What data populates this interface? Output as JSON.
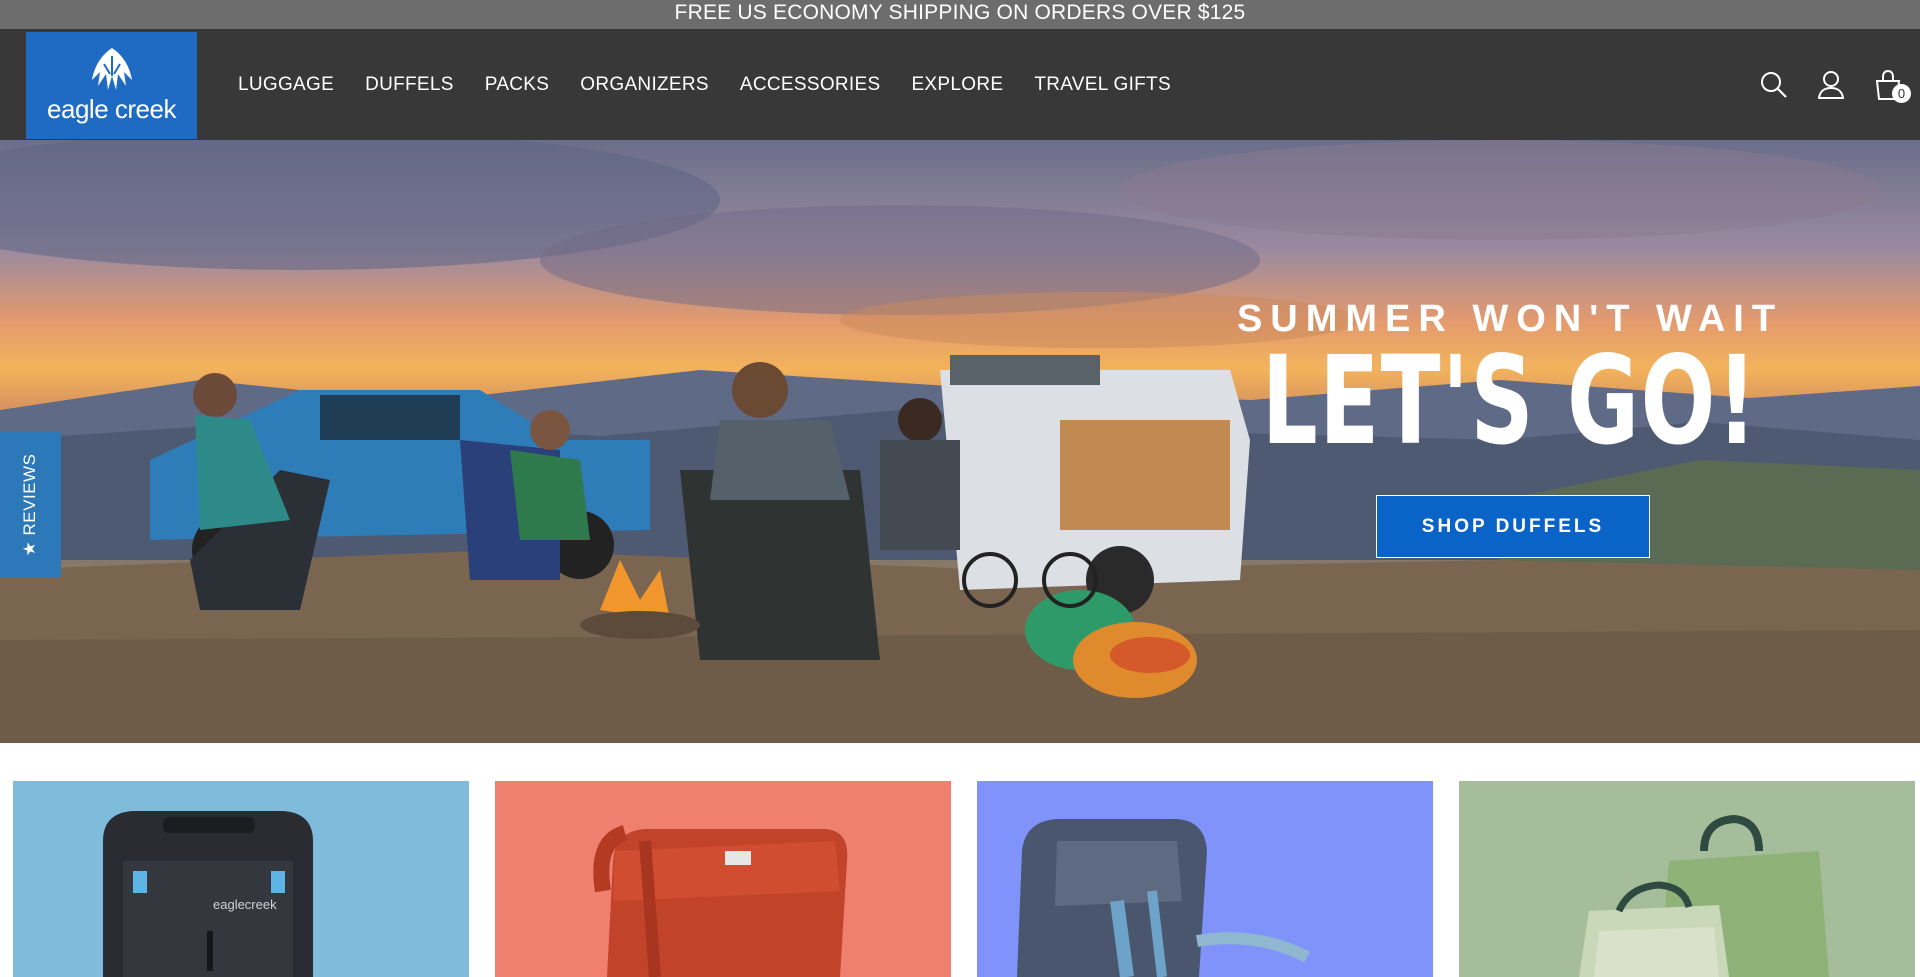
{
  "announcement": {
    "text": "FREE US ECONOMY SHIPPING ON ORDERS OVER $125"
  },
  "header": {
    "logo_text": "eagle creek",
    "nav": [
      "LUGGAGE",
      "DUFFELS",
      "PACKS",
      "ORGANIZERS",
      "ACCESSORIES",
      "EXPLORE",
      "TRAVEL GIFTS"
    ],
    "icons": [
      "search-icon",
      "account-icon",
      "cart-icon"
    ],
    "cart_count": "0"
  },
  "hero": {
    "eyebrow": "SUMMER WON'T WAIT",
    "title": "LET'S GO!",
    "cta": "SHOP DUFFELS"
  },
  "reviews_tab": {
    "label": "★ REVIEWS"
  },
  "tiles": [
    {
      "bg": "#7fbcdc",
      "product": "rolling-luggage"
    },
    {
      "bg": "#ef7f6e",
      "product": "backpack"
    },
    {
      "bg": "#7f93fb",
      "product": "duffel-pack"
    },
    {
      "bg": "#a6bd9c",
      "product": "packing-cubes"
    }
  ],
  "colors": {
    "brand_blue": "#1f6bc4",
    "cta_blue": "#0a64c8",
    "header_bg": "#383838",
    "announce_bg": "#6d6d6d"
  }
}
